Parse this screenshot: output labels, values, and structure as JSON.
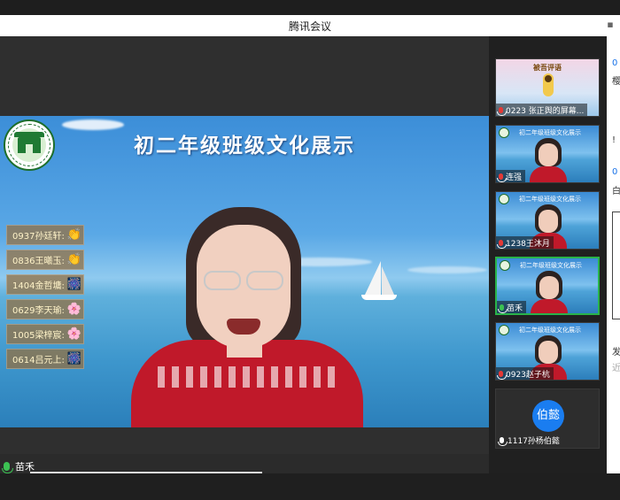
{
  "window": {
    "title": "腾讯会议"
  },
  "main_video": {
    "banner": "初二年级班级文化展示",
    "gifts": [
      {
        "label": "0937孙廷轩:",
        "icon": "clapping-hands-icon",
        "glyph": "👏"
      },
      {
        "label": "0836王曦玉:",
        "icon": "clapping-hands-icon",
        "glyph": "👏"
      },
      {
        "label": "1404金哲墉:",
        "icon": "fireworks-icon",
        "glyph": "🎆"
      },
      {
        "label": "0629李天瑜:",
        "icon": "flower-icon",
        "glyph": "🌸"
      },
      {
        "label": "1005梁梓宸:",
        "icon": "flower-icon",
        "glyph": "🌸"
      },
      {
        "label": "0614吕元上:",
        "icon": "fireworks-icon",
        "glyph": "🎆"
      }
    ]
  },
  "speaker_label": {
    "name": "苗禾"
  },
  "participants": [
    {
      "name": "0223 张正舆的屏幕...",
      "tile": "slide",
      "slide_title": "被吾评语",
      "title": ""
    },
    {
      "name": "连强",
      "tile": "video",
      "title": "初二年级班级文化展示"
    },
    {
      "name": "1238王沐月",
      "tile": "video",
      "title": "初二年级班级文化展示"
    },
    {
      "name": "苗禾",
      "tile": "video",
      "title": "初二年级班级文化展示",
      "active": true
    },
    {
      "name": "0923赵子杭",
      "tile": "video",
      "title": "初二年级班级文化展示"
    },
    {
      "name": "1117孙杨伯懿",
      "tile": "avatar",
      "avatar_text": "伯懿"
    }
  ],
  "chat_peek": [
    "0",
    "樱",
    "!",
    "0",
    "白",
    "发",
    "近"
  ],
  "colors": {
    "accent": "#1a7df0",
    "active_border": "#29b34a",
    "mic_on": "#3cc253"
  }
}
